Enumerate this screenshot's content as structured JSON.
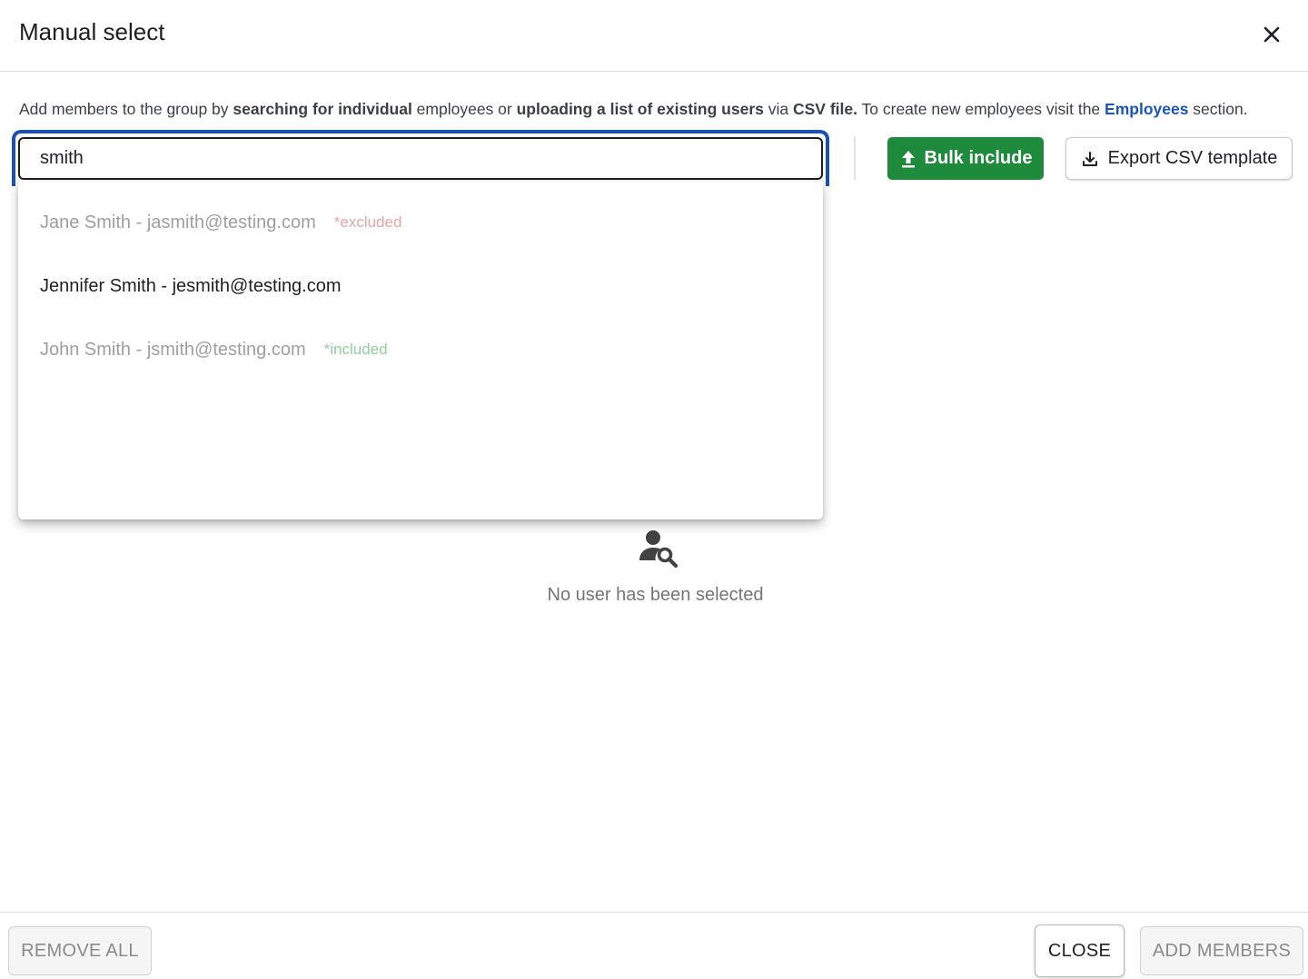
{
  "dialog": {
    "title": "Manual select"
  },
  "description": {
    "part1": "Add members to the group by ",
    "bold1": "searching for individual",
    "part2": " employees or ",
    "bold2": "uploading a list of existing users",
    "part3": " via ",
    "bold3": "CSV file.",
    "part4": " To create new employees visit the ",
    "link": "Employees",
    "part5": " section."
  },
  "search": {
    "value": "smith",
    "placeholder": ""
  },
  "actions": {
    "bulk_include_label": "Bulk include",
    "export_label": "Export CSV template"
  },
  "results": [
    {
      "name": "Jane Smith - jasmith@testing.com",
      "tag": "*excluded",
      "state": "excluded"
    },
    {
      "name": "Jennifer Smith - jesmith@testing.com",
      "tag": "",
      "state": "available"
    },
    {
      "name": "John Smith - jsmith@testing.com",
      "tag": "*included",
      "state": "included"
    }
  ],
  "empty_state": {
    "icon": "person-search-icon",
    "text": "No user has been selected"
  },
  "footer": {
    "remove_all_label": "REMOVE ALL",
    "close_label": "CLOSE",
    "add_members_label": "ADD MEMBERS"
  },
  "colors": {
    "primary_blue": "#1a4fb5",
    "bulk_green": "#1e8a3c",
    "excluded_tag": "#e8a4a4",
    "included_tag": "#91cf9c"
  }
}
